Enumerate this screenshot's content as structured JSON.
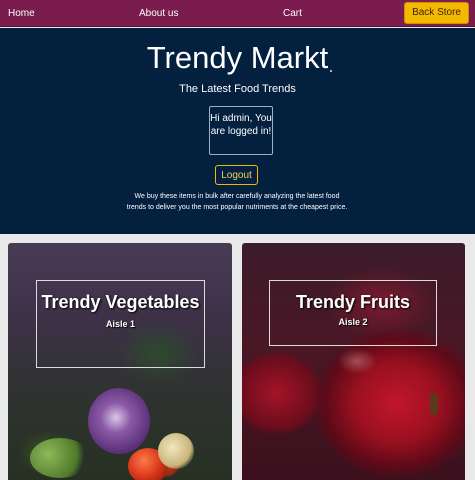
{
  "nav": {
    "home": "Home",
    "about": "About us",
    "cart": "Cart",
    "back_store": "Back Store"
  },
  "hero": {
    "title": "Trendy Markt",
    "subtitle": "The Latest Food Trends",
    "greeting": "Hi admin, You are logged in!",
    "logout": "Logout",
    "description": "We buy these items in bulk after carefully analyzing the latest food trends to deliver you the most popular nutriments at the cheapest price."
  },
  "cards": [
    {
      "title": "Trendy Vegetables",
      "aisle": "Aisle 1"
    },
    {
      "title": "Trendy Fruits",
      "aisle": "Aisle 2"
    }
  ],
  "colors": {
    "navbar": "#7a1d4e",
    "hero_bg": "#03203f",
    "accent": "#f5b800",
    "page_bg": "#e9e9e9"
  }
}
